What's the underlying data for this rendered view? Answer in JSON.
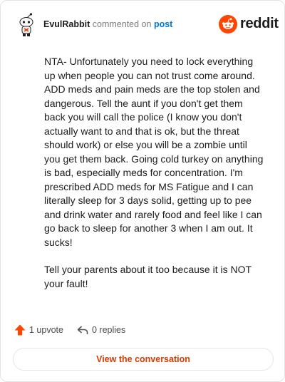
{
  "header": {
    "username": "EvulRabbit",
    "action_text": "commented on",
    "post_link": "post",
    "brand_name": "reddit",
    "brand_color": "#ff4500"
  },
  "comment": {
    "paragraphs": [
      "NTA- Unfortunately you need to lock everything up when people you can not trust come around. ADD meds and pain meds are the top stolen and dangerous. Tell the aunt if you don't get them back you will call the police (I know you don't actually want to and that is ok, but the threat should work) or else you will be a zombie until you get them back. Going cold turkey on anything is bad, especially meds for concentration. I'm prescribed ADD meds for MS Fatigue and I can literally sleep for 3 days solid, getting up to pee and drink water and rarely food and feel like I can go back to sleep for another 3 when I am out. It sucks!",
      "Tell your parents about it too because it is NOT your fault!"
    ]
  },
  "actions": {
    "upvote_label": "1 upvote",
    "upvote_icon": "upvote-arrow-icon",
    "replies_label": "0 replies",
    "replies_icon": "reply-arrow-icon"
  },
  "footer": {
    "view_label": "View the conversation",
    "accent_color": "#d93a00"
  }
}
